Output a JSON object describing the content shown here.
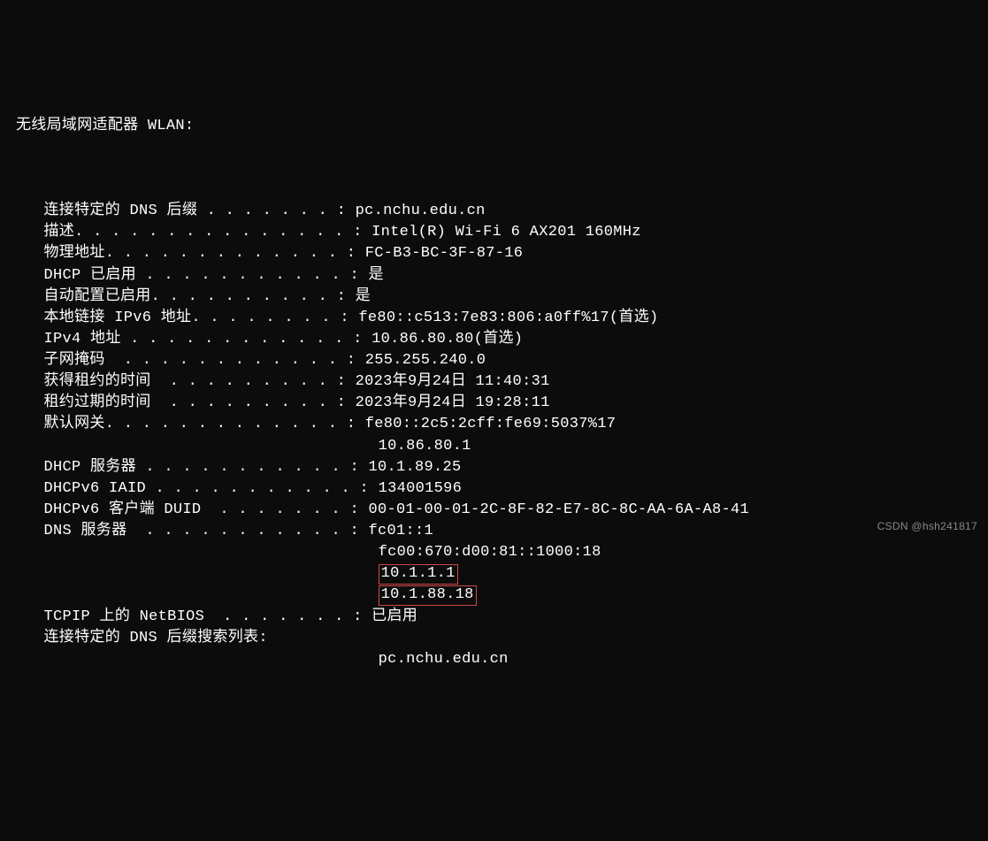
{
  "header": "无线局域网适配器 WLAN:",
  "rows": [
    {
      "label": "   连接特定的 DNS 后缀 . . . . . . . :",
      "value": " pc.nchu.edu.cn"
    },
    {
      "label": "   描述. . . . . . . . . . . . . . . :",
      "value": " Intel(R) Wi-Fi 6 AX201 160MHz"
    },
    {
      "label": "   物理地址. . . . . . . . . . . . . :",
      "value": " FC-B3-BC-3F-87-16"
    },
    {
      "label": "   DHCP 已启用 . . . . . . . . . . . :",
      "value": " 是"
    },
    {
      "label": "   自动配置已启用. . . . . . . . . . :",
      "value": " 是"
    },
    {
      "label": "   本地链接 IPv6 地址. . . . . . . . :",
      "value": " fe80::c513:7e83:806:a0ff%17(首选)"
    },
    {
      "label": "   IPv4 地址 . . . . . . . . . . . . :",
      "value": " 10.86.80.80(首选)"
    },
    {
      "label": "   子网掩码  . . . . . . . . . . . . :",
      "value": " 255.255.240.0"
    },
    {
      "label": "   获得租约的时间  . . . . . . . . . :",
      "value": " 2023年9月24日 11:40:31"
    },
    {
      "label": "   租约过期的时间  . . . . . . . . . :",
      "value": " 2023年9月24日 19:28:11"
    },
    {
      "label": "   默认网关. . . . . . . . . . . . . :",
      "value": " fe80::2c5:2cff:fe69:5037%17"
    },
    {
      "label": "                                      ",
      "value": " 10.86.80.1"
    },
    {
      "label": "   DHCP 服务器 . . . . . . . . . . . :",
      "value": " 10.1.89.25"
    },
    {
      "label": "   DHCPv6 IAID . . . . . . . . . . . :",
      "value": " 134001596"
    },
    {
      "label": "   DHCPv6 客户端 DUID  . . . . . . . :",
      "value": " 00-01-00-01-2C-8F-82-E7-8C-8C-AA-6A-A8-41"
    },
    {
      "label": "   DNS 服务器  . . . . . . . . . . . :",
      "value": " fc01::1"
    },
    {
      "label": "                                      ",
      "value": " fc00:670:d00:81::1000:18"
    },
    {
      "label": "                                       ",
      "value": "10.1.1.1",
      "highlight": true
    },
    {
      "label": "                                       ",
      "value": "10.1.88.18",
      "highlight": true
    },
    {
      "label": "   TCPIP 上的 NetBIOS  . . . . . . . :",
      "value": " 已启用"
    },
    {
      "label": "   连接特定的 DNS 后缀搜索列表:",
      "value": ""
    },
    {
      "label": "                                      ",
      "value": " pc.nchu.edu.cn"
    }
  ],
  "watermark": "CSDN @hsh241817"
}
